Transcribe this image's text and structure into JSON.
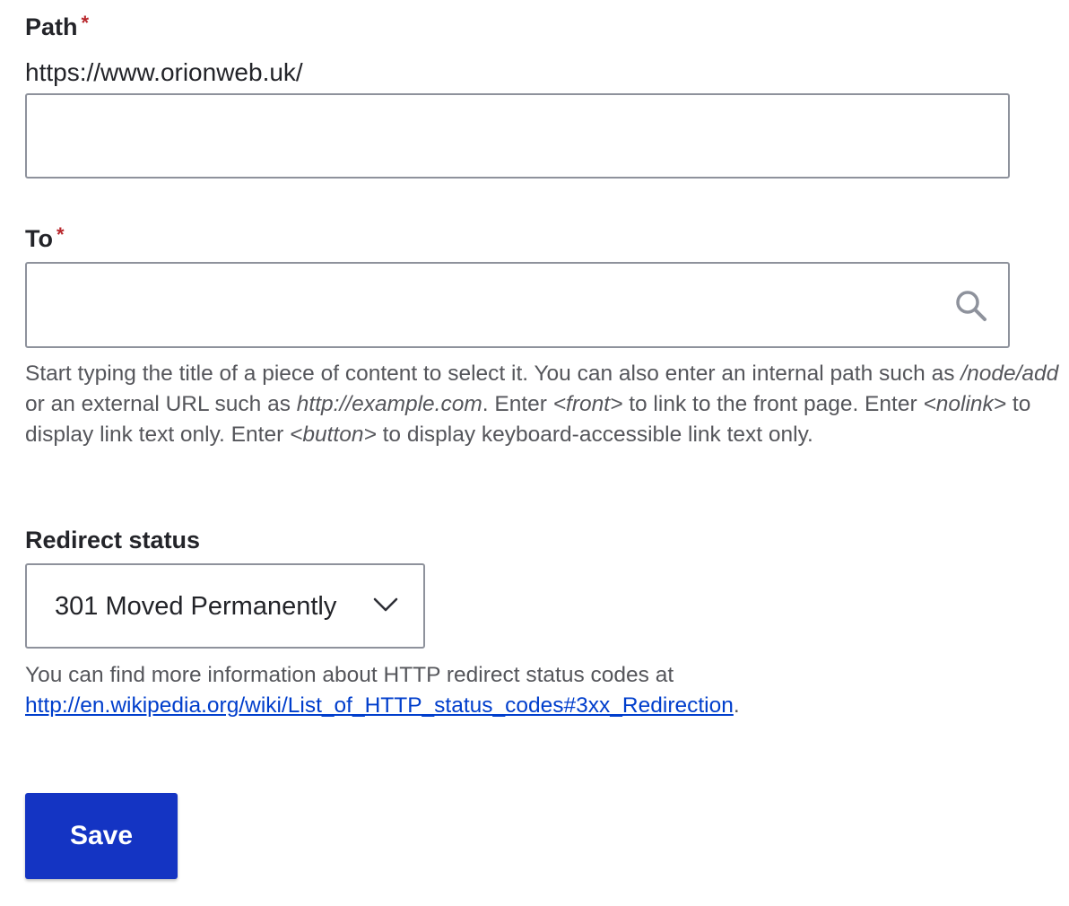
{
  "path_field": {
    "label": "Path",
    "required_marker": "*",
    "prefix": "https://www.orionweb.uk/",
    "value": "",
    "placeholder": ""
  },
  "to_field": {
    "label": "To",
    "required_marker": "*",
    "value": "",
    "placeholder": "",
    "icon": "search-icon",
    "description": {
      "p1": "Start typing the title of a piece of content to select it. You can also enter an internal path such as ",
      "e1": "/node/add",
      "p2": " or an external URL such as ",
      "e2": "http://example.com",
      "p3": ". Enter ",
      "e3": "<front>",
      "p4": " to link to the front page. Enter ",
      "e4": "<nolink>",
      "p5": " to display link text only. Enter ",
      "e5": "<button>",
      "p6": " to display keyboard-accessible link text only."
    }
  },
  "redirect_status": {
    "label": "Redirect status",
    "selected": "301 Moved Permanently",
    "icon": "chevron-down-icon",
    "description_text": "You can find more information about HTTP redirect status codes at ",
    "link_text": "http://en.wikipedia.org/wiki/List_of_HTTP_status_codes#3xx_Redirection",
    "after_link": "."
  },
  "actions": {
    "save_label": "Save"
  },
  "colors": {
    "required": "#b8272c",
    "link": "#003ecc",
    "primary_button": "#1434c3",
    "border": "#8e929c"
  }
}
